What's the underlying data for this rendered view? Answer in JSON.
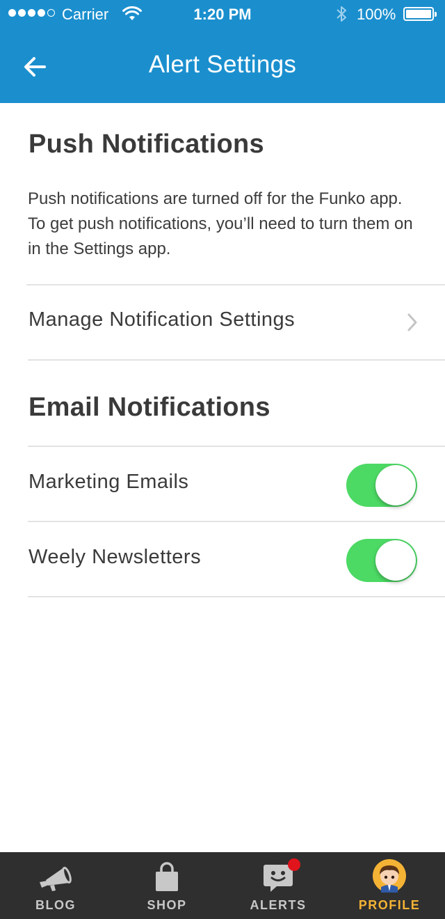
{
  "status_bar": {
    "carrier": "Carrier",
    "time": "1:20 PM",
    "battery": "100%",
    "signal_bars_filled": 4,
    "signal_bars_total": 5
  },
  "nav": {
    "back_icon": "arrow-left-icon",
    "title": "Alert Settings"
  },
  "push": {
    "title": "Push Notifications",
    "description": "Push notifications are turned off for the Funko app. To get push notifications, you’ll need to turn them on in the Settings app.",
    "manage_label": "Manage Notification Settings"
  },
  "email": {
    "title": "Email Notifications",
    "items": [
      {
        "label": "Marketing Emails",
        "enabled": true
      },
      {
        "label": "Weely Newsletters",
        "enabled": true
      }
    ]
  },
  "tabbar": {
    "tabs": [
      {
        "label": "BLOG",
        "icon": "megaphone-icon",
        "active": false
      },
      {
        "label": "SHOP",
        "icon": "shopping-bag-icon",
        "active": false
      },
      {
        "label": "ALERTS",
        "icon": "chat-bubble-face-icon",
        "active": false,
        "badge": true
      },
      {
        "label": "PROFILE",
        "icon": "avatar-icon",
        "active": true
      }
    ]
  },
  "colors": {
    "header": "#1b8fce",
    "toggle_on": "#4cd964",
    "tabbar_bg": "#2f2f2f",
    "tab_active": "#f5b335",
    "badge": "#e1141c"
  }
}
